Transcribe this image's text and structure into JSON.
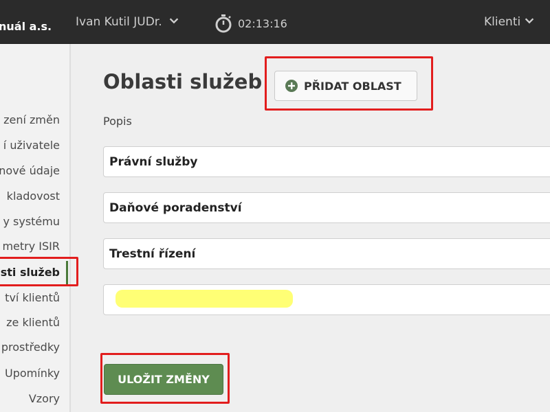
{
  "header": {
    "company": "nuál a.s.",
    "user": "Ivan Kutil JUDr.",
    "timer": "02:13:16",
    "clients_menu": "Klienti",
    "chevron_icon": "chevron-down-icon",
    "timer_icon": "stopwatch-icon"
  },
  "sidebar": {
    "items": [
      {
        "label": "zení změn"
      },
      {
        "label": "í uživatele"
      },
      {
        "label": "nové údaje"
      },
      {
        "label": "kladovost"
      },
      {
        "label": "y systému"
      },
      {
        "label": "metry ISIR"
      },
      {
        "label": "sti služeb",
        "active": true
      },
      {
        "label": "tví klientů"
      },
      {
        "label": "ze klientů"
      },
      {
        "label": "prostředky"
      },
      {
        "label": "Upomínky"
      },
      {
        "label": "Vzory"
      }
    ]
  },
  "main": {
    "title": "Oblasti služeb",
    "add_button": "PŘIDAT OBLAST",
    "add_icon": "plus-circle-icon",
    "description_label": "Popis",
    "fields": [
      {
        "value": "Právní služby"
      },
      {
        "value": "Daňové poradenství"
      },
      {
        "value": "Trestní řízení"
      },
      {
        "value": ""
      }
    ],
    "save_button": "ULOŽIT ZMĚNY"
  },
  "colors": {
    "topbar": "#2b2b2b",
    "accent_green": "#5e8c51",
    "annotation_red": "#e21d1d",
    "highlight_yellow": "#ffff66"
  }
}
